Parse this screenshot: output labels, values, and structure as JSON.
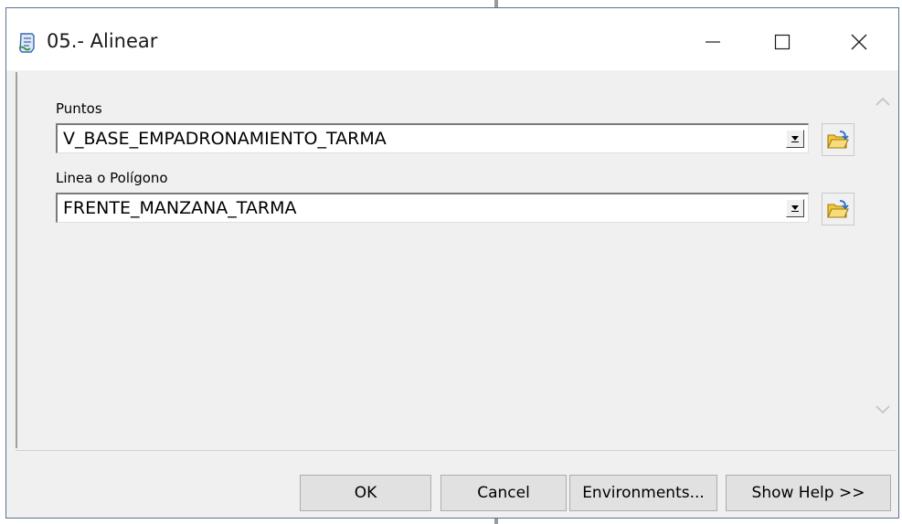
{
  "window": {
    "title": "05.- Alinear"
  },
  "fields": {
    "points": {
      "label": "Puntos",
      "value": "V_BASE_EMPADRONAMIENTO_TARMA"
    },
    "line_polygon": {
      "label": "Linea o Polígono",
      "value": "FRENTE_MANZANA_TARMA"
    }
  },
  "buttons": {
    "ok": "OK",
    "cancel": "Cancel",
    "environments": "Environments...",
    "show_help": "Show Help >>"
  },
  "icons": {
    "app": "script-tool-icon",
    "browse": "open-folder-icon",
    "dropdown": "dropdown-arrow-icon"
  },
  "colors": {
    "window_border": "#5a6f94",
    "dialog_bg": "#f0f0f0",
    "button_bg": "#e1e1e1",
    "folder_yellow": "#f2c53d"
  }
}
